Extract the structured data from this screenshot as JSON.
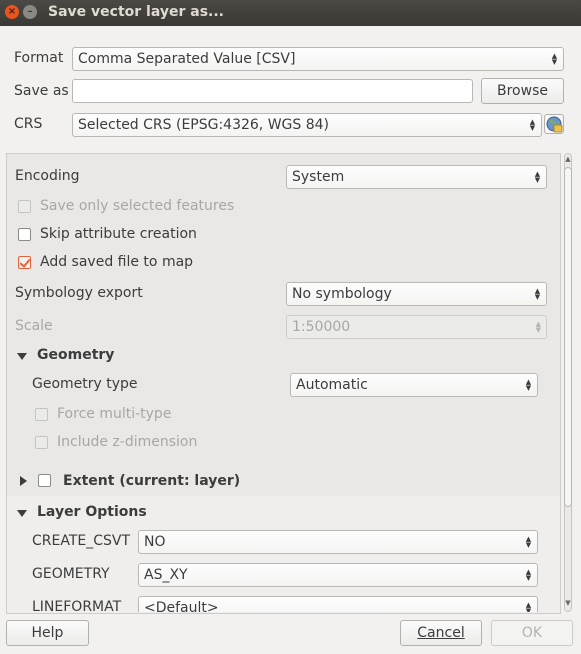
{
  "window": {
    "title": "Save vector layer as..."
  },
  "icons": {
    "close": "close-icon",
    "minimize": "minimize-icon",
    "crs": "crs-globe-icon",
    "expanded": "triangle-down-icon",
    "collapsed": "triangle-right-icon",
    "combo_arrows": "up-down-arrows-icon"
  },
  "colors": {
    "titlebar": "#3c3b37",
    "close": "#e9541f",
    "check_accent": "#e4623a"
  },
  "format": {
    "label": "Format",
    "value": "Comma Separated Value [CSV]"
  },
  "save_as": {
    "label": "Save as",
    "value": "",
    "browse": "Browse"
  },
  "crs": {
    "label": "CRS",
    "value": "Selected CRS (EPSG:4326, WGS 84)"
  },
  "options": {
    "encoding": {
      "label": "Encoding",
      "value": "System"
    },
    "save_only_selected": {
      "label": "Save only selected features",
      "checked": false,
      "enabled": false
    },
    "skip_attribute": {
      "label": "Skip attribute creation",
      "checked": false
    },
    "add_to_map": {
      "label": "Add saved file to map",
      "checked": true
    },
    "symbology": {
      "label": "Symbology export",
      "value": "No symbology"
    },
    "scale": {
      "label": "Scale",
      "value": "1:50000",
      "enabled": false
    }
  },
  "geometry": {
    "title": "Geometry",
    "type_label": "Geometry type",
    "type_value": "Automatic",
    "force_multi": {
      "label": "Force multi-type",
      "checked": false,
      "enabled": false
    },
    "include_z": {
      "label": "Include z-dimension",
      "checked": false,
      "enabled": false
    }
  },
  "extent": {
    "title": "Extent (current: layer)",
    "checked": false
  },
  "layer_options": {
    "title": "Layer Options",
    "rows": [
      {
        "label": "CREATE_CSVT",
        "value": "NO"
      },
      {
        "label": "GEOMETRY",
        "value": "AS_XY"
      },
      {
        "label": "LINEFORMAT",
        "value": "<Default>"
      }
    ]
  },
  "buttons": {
    "help": "Help",
    "cancel": "Cancel",
    "ok": "OK"
  }
}
